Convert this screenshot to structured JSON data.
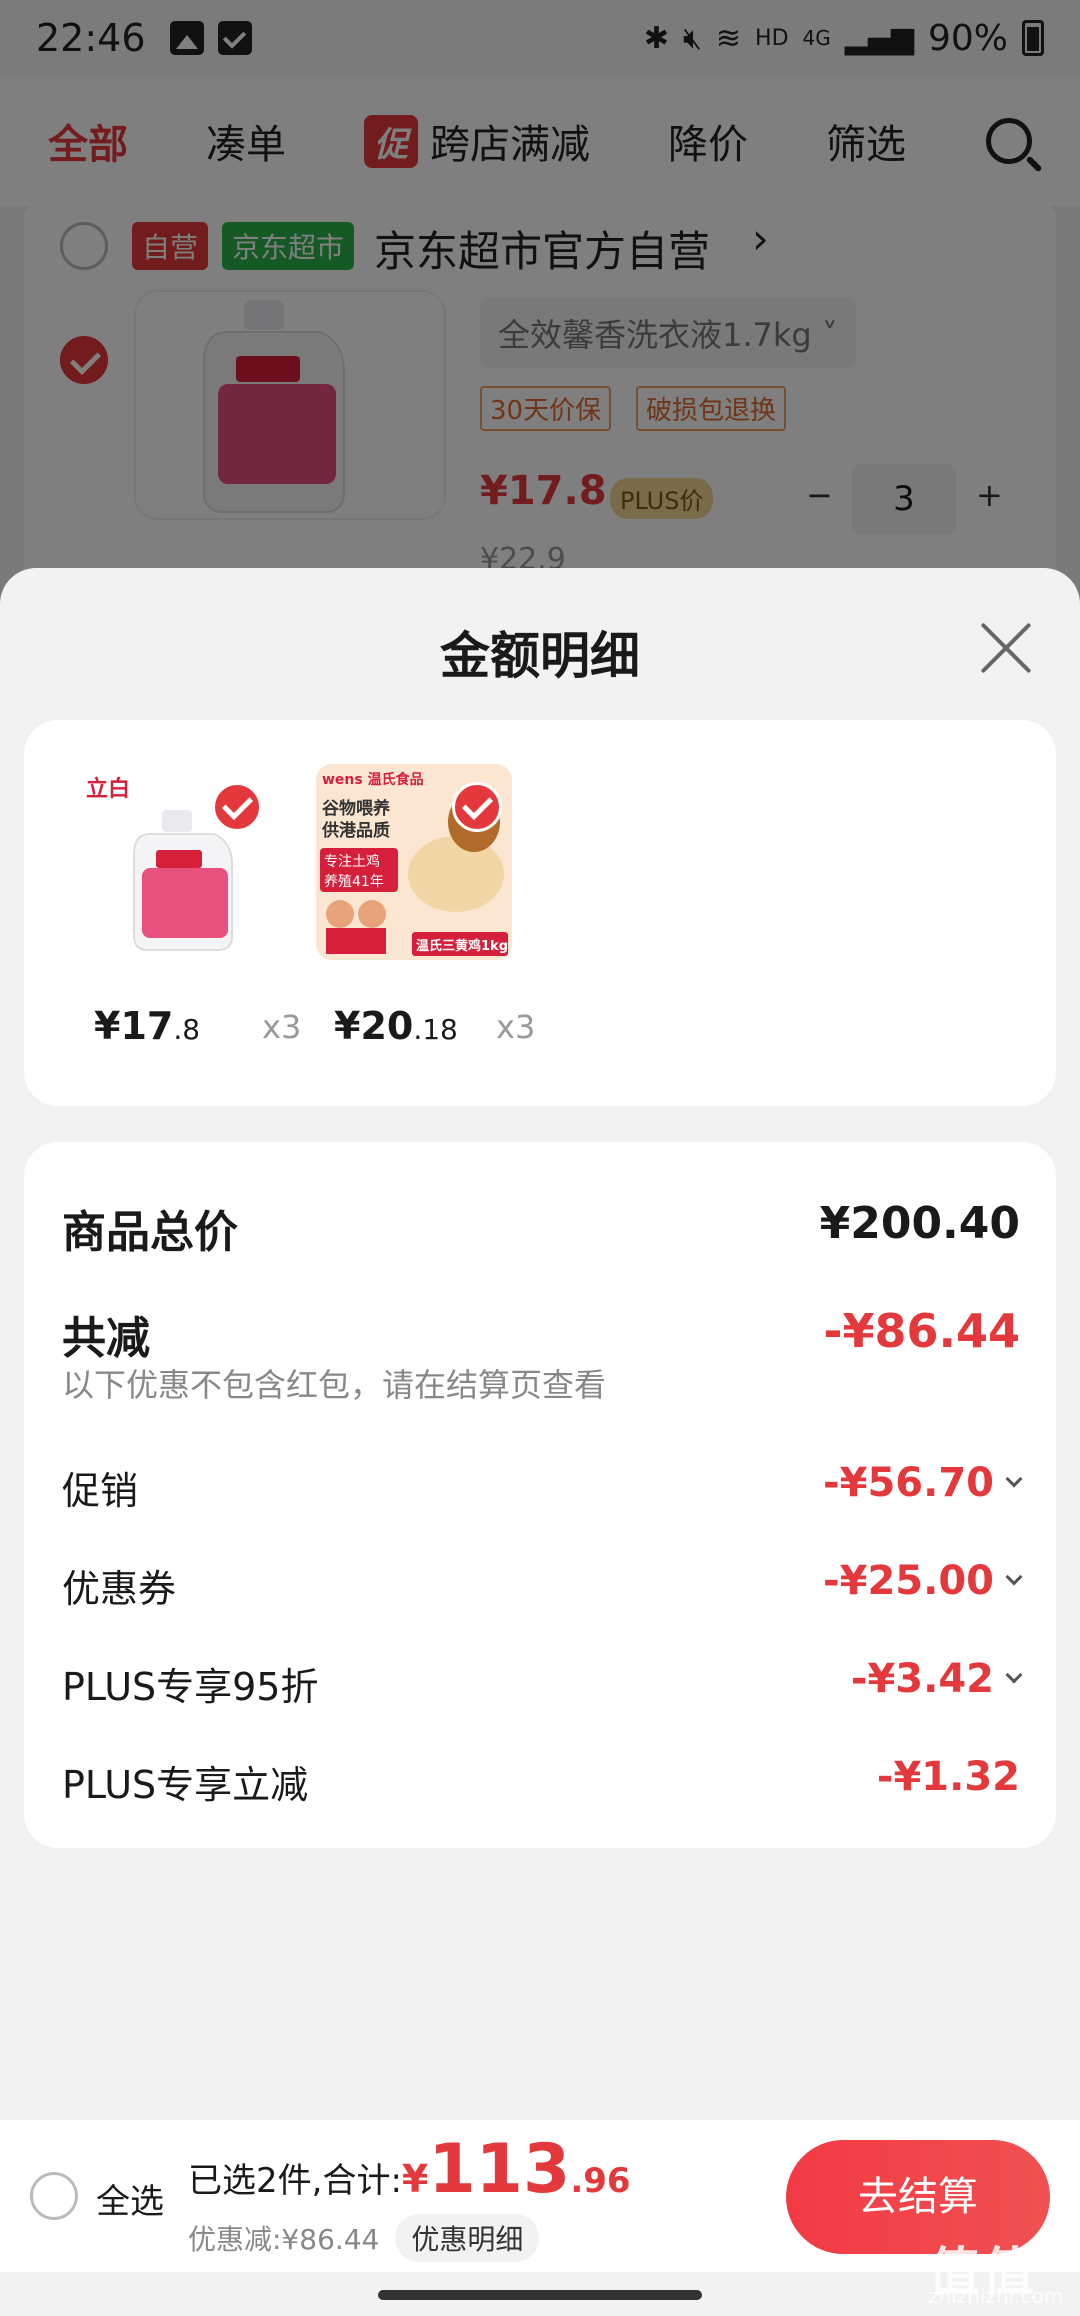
{
  "status_bar": {
    "time": "22:46",
    "network": "HD",
    "signal": "4G",
    "battery": "90%"
  },
  "filter_bar": {
    "tabs": [
      "全部",
      "凑单",
      "跨店满减",
      "降价",
      "筛选"
    ],
    "promo_badge": "促"
  },
  "store": {
    "tag_self": "自营",
    "tag_market": "京东超市",
    "name": "京东超市官方自营",
    "arrow": "›"
  },
  "cart_item": {
    "spec": "全效馨香洗衣液1.7kg",
    "spec_arrow": "˅",
    "service_tags": [
      "30天价保",
      "破损包退换"
    ],
    "price": "¥17.8",
    "plus_label": "PLUS价",
    "old_price": "¥22.9",
    "qty": "3",
    "minus": "−",
    "plus": "+"
  },
  "sheet": {
    "title": "金额明细",
    "goods": [
      {
        "price_int": "¥17",
        "price_dec": ".8",
        "qty": "x3",
        "image": "laundry-detergent",
        "brand": "立白"
      },
      {
        "price_int": "¥20",
        "price_dec": ".18",
        "qty": "x3",
        "image": "whole-chicken",
        "brand": "wens 温氏食品",
        "lines": [
          "谷物喂养",
          "供港品质",
          "专注土鸡",
          "养殖41年",
          "温氏三黄鸡1kg"
        ]
      }
    ],
    "total_label": "商品总价",
    "total_value": "¥200.40",
    "discount_label": "共减",
    "discount_value": "-¥86.44",
    "discount_note": "以下优惠不包含红包，请在结算页查看",
    "rows": [
      {
        "label": "促销",
        "value": "-¥56.70",
        "expandable": true
      },
      {
        "label": "优惠券",
        "value": "-¥25.00",
        "expandable": true
      },
      {
        "label": "PLUS专享95折",
        "value": "-¥3.42",
        "expandable": true
      },
      {
        "label": "PLUS专享立减",
        "value": "-¥1.32",
        "expandable": false
      }
    ]
  },
  "bottom_bar": {
    "select_all": "全选",
    "selected_text": "已选2件,合计:",
    "currency": "¥",
    "total_int": "113",
    "total_dec": ".96",
    "discount_text": "优惠减:¥86.44",
    "detail_button": "优惠明细",
    "checkout": "去结算"
  },
  "watermark": {
    "main": "值值值",
    "sub": "zhizhizhi.com"
  },
  "colors": {
    "accent": "#e4393c",
    "green_tag": "#2ab24b",
    "plus_gold": "#f4d694"
  }
}
